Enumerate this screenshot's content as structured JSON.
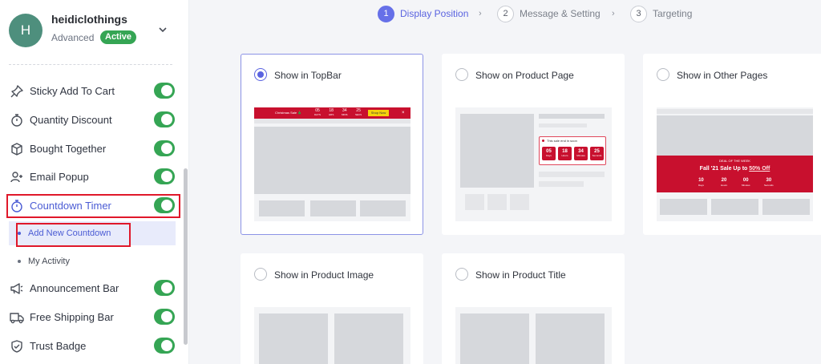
{
  "store": {
    "avatar_initial": "H",
    "name": "heidiclothings",
    "plan": "Advanced",
    "status": "Active"
  },
  "sidebar": {
    "items": [
      {
        "label": "Sticky Add To Cart",
        "icon": "pin-icon",
        "enabled": true
      },
      {
        "label": "Quantity Discount",
        "icon": "stopwatch-icon",
        "enabled": true
      },
      {
        "label": "Bought Together",
        "icon": "box-icon",
        "enabled": true
      },
      {
        "label": "Email Popup",
        "icon": "user-plus-icon",
        "enabled": true
      },
      {
        "label": "Countdown Timer",
        "icon": "stopwatch-icon",
        "enabled": true
      },
      {
        "label": "Announcement Bar",
        "icon": "megaphone-icon",
        "enabled": true
      },
      {
        "label": "Free Shipping Bar",
        "icon": "truck-icon",
        "enabled": true
      },
      {
        "label": "Trust Badge",
        "icon": "shield-icon",
        "enabled": true
      }
    ],
    "sub_items": [
      {
        "label": "Add New Countdown",
        "selected": true
      },
      {
        "label": "My Activity",
        "selected": false
      }
    ]
  },
  "stepper": {
    "steps": [
      {
        "num": "1",
        "label": "Display Position",
        "current": true
      },
      {
        "num": "2",
        "label": "Message & Setting",
        "current": false
      },
      {
        "num": "3",
        "label": "Targeting",
        "current": false
      }
    ],
    "separator": "›"
  },
  "cards": [
    {
      "label": "Show in TopBar",
      "selected": true
    },
    {
      "label": "Show on Product Page",
      "selected": false
    },
    {
      "label": "Show in Other Pages",
      "selected": false
    },
    {
      "label": "Show in Product Image",
      "selected": false
    },
    {
      "label": "Show in Product Title",
      "selected": false
    }
  ],
  "previews": {
    "topbar": {
      "text": "Christmas Sale 🎄",
      "timer": [
        {
          "value": "05",
          "unit": "DAYS"
        },
        {
          "value": "18",
          "unit": "HRS"
        },
        {
          "value": "34",
          "unit": "MINS"
        },
        {
          "value": "25",
          "unit": "SECS"
        }
      ],
      "button": "Shop Now",
      "close": "×"
    },
    "product": {
      "notice": "This sale end in soon",
      "timer": [
        {
          "value": "05",
          "unit": "Days"
        },
        {
          "value": "18",
          "unit": "Hours"
        },
        {
          "value": "34",
          "unit": "Minutes"
        },
        {
          "value": "25",
          "unit": "Seconds"
        }
      ]
    },
    "other": {
      "eyebrow": "DEAL OF THE WEEK",
      "headline_prefix": "Fall '21 Sale Up to ",
      "headline_highlight": "50% Off",
      "timer": [
        {
          "value": "10",
          "unit": "Days"
        },
        {
          "value": "20",
          "unit": "Hours"
        },
        {
          "value": "00",
          "unit": "Minutes"
        },
        {
          "value": "30",
          "unit": "Seconds"
        }
      ]
    }
  },
  "colors": {
    "accent": "#5a63e0",
    "toggle_on": "#35a554",
    "highlight": "#e0182a",
    "promo_red": "#c8102e"
  }
}
